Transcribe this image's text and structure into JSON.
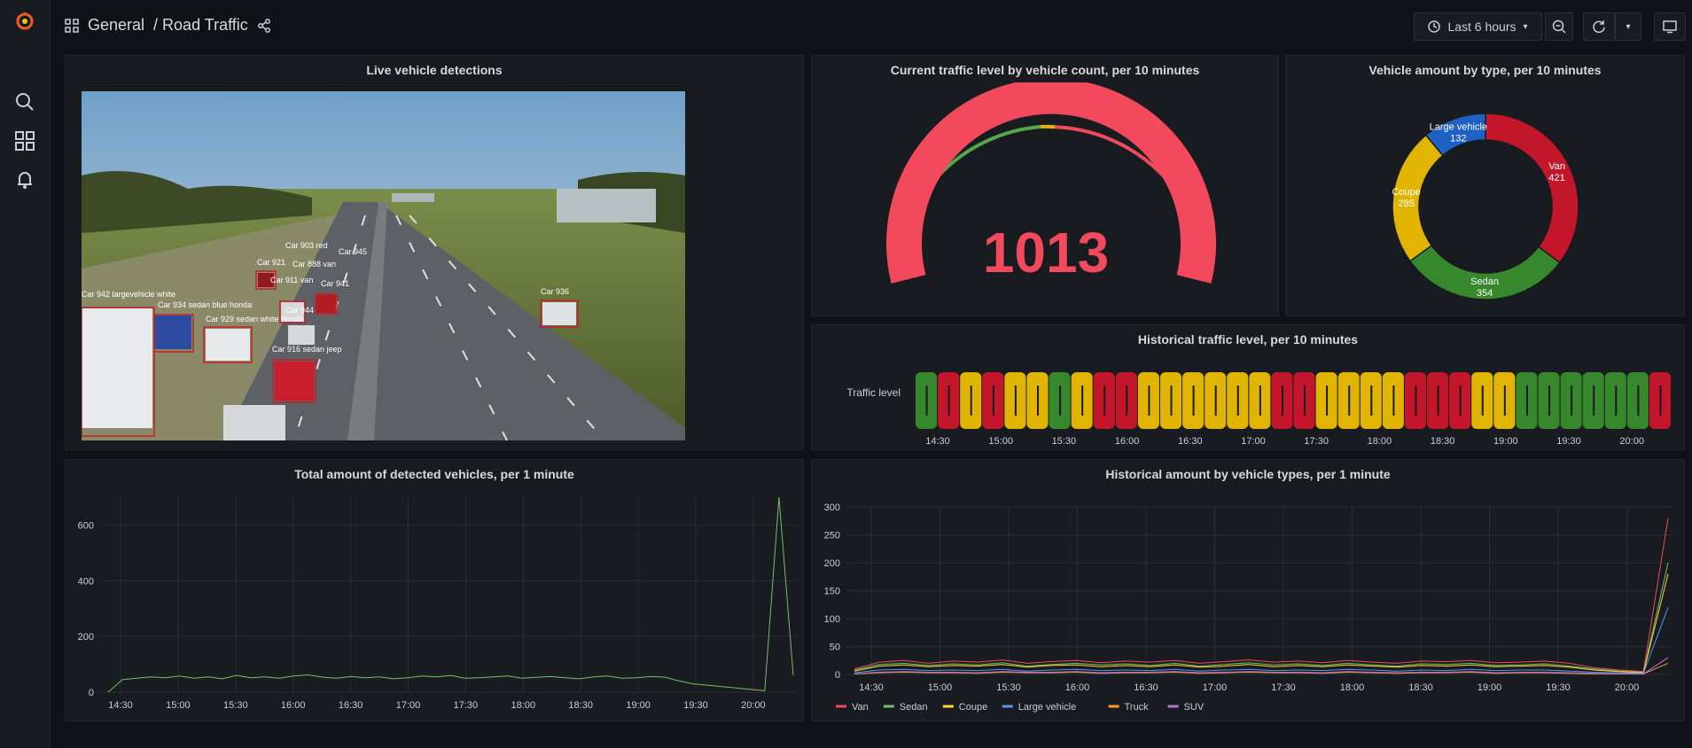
{
  "breadcrumb": {
    "folder": "General",
    "title": "/ Road Traffic"
  },
  "toolbar": {
    "time_range": "Last 6 hours"
  },
  "panels": {
    "live": {
      "title": "Live vehicle detections"
    },
    "gauge": {
      "title": "Current traffic level by vehicle count, per 10 minutes",
      "value": "1013",
      "min": 0,
      "max": 1000
    },
    "pie": {
      "title": "Vehicle amount by type, per 10 minutes"
    },
    "hist_level": {
      "title": "Historical traffic level, per 10 minutes",
      "row_label": "Traffic level"
    },
    "total": {
      "title": "Total amount of detected vehicles, per 1 minute"
    },
    "types": {
      "title": "Historical amount by vehicle types, per 1 minute"
    }
  },
  "detections": [
    "Car 942 largevehicle white",
    "Car 934 sedan blue honda",
    "Car 929 sedan white honda",
    "Car 921",
    "Car 903 red",
    "Car 888 van",
    "Car 945",
    "Car 911 van",
    "Car 941",
    "Car 944",
    "Car 916 sedan jeep",
    "Car 936"
  ],
  "colors": {
    "red": "#f2495c",
    "green": "#56a64b",
    "yellow": "#e0b400",
    "blue": "#3274d9",
    "orange": "#ff780a",
    "purple": "#a352cc"
  },
  "chart_data": [
    {
      "type": "pie",
      "title": "Vehicle amount by type, per 10 minutes",
      "slices": [
        {
          "name": "Van",
          "value": 421,
          "color": "#c4162a"
        },
        {
          "name": "Sedan",
          "value": 354,
          "color": "#37872d"
        },
        {
          "name": "Coupe",
          "value": 285,
          "color": "#e0b400"
        },
        {
          "name": "Large vehicle",
          "value": 132,
          "color": "#1f60c4"
        }
      ]
    },
    {
      "type": "heatmap",
      "title": "Historical traffic level, per 10 minutes",
      "row_label": "Traffic level",
      "x_ticks": [
        "14:30",
        "15:00",
        "15:30",
        "16:00",
        "16:30",
        "17:00",
        "17:30",
        "18:00",
        "18:30",
        "19:00",
        "19:30",
        "20:00"
      ],
      "levels": [
        "green",
        "red",
        "yellow",
        "red",
        "yellow",
        "yellow",
        "green",
        "yellow",
        "red",
        "red",
        "yellow",
        "yellow",
        "yellow",
        "yellow",
        "yellow",
        "yellow",
        "red",
        "red",
        "yellow",
        "yellow",
        "yellow",
        "yellow",
        "red",
        "red",
        "red",
        "yellow",
        "yellow",
        "green",
        "green",
        "green",
        "green",
        "green",
        "green",
        "red"
      ]
    },
    {
      "type": "line",
      "title": "Total amount of detected vehicles, per 1 minute",
      "x_ticks": [
        "14:30",
        "15:00",
        "15:30",
        "16:00",
        "16:30",
        "17:00",
        "17:30",
        "18:00",
        "18:30",
        "19:00",
        "19:30",
        "20:00"
      ],
      "ylim": [
        0,
        700
      ],
      "y_ticks": [
        0,
        200,
        400,
        600
      ],
      "series": [
        {
          "color": "#73bf69",
          "values": [
            0,
            45,
            50,
            55,
            52,
            58,
            50,
            55,
            48,
            60,
            52,
            55,
            50,
            58,
            62,
            54,
            50,
            56,
            52,
            55,
            48,
            52,
            58,
            55,
            60,
            50,
            52,
            55,
            58,
            50,
            53,
            56,
            52,
            48,
            55,
            58,
            50,
            52,
            56,
            54,
            40,
            30,
            25,
            20,
            15,
            10,
            5,
            700,
            60
          ]
        }
      ]
    },
    {
      "type": "line",
      "title": "Historical amount by vehicle types, per 1 minute",
      "x_ticks": [
        "14:30",
        "15:00",
        "15:30",
        "16:00",
        "16:30",
        "17:00",
        "17:30",
        "18:00",
        "18:30",
        "19:00",
        "19:30",
        "20:00"
      ],
      "ylim": [
        0,
        300
      ],
      "y_ticks": [
        0,
        50,
        100,
        150,
        200,
        250,
        300
      ],
      "series": [
        {
          "name": "Van",
          "color": "#f2495c",
          "values": [
            10,
            22,
            25,
            20,
            24,
            22,
            26,
            20,
            23,
            25,
            21,
            24,
            22,
            25,
            20,
            23,
            26,
            22,
            24,
            21,
            25,
            22,
            20,
            24,
            23,
            25,
            21,
            22,
            24,
            20,
            12,
            8,
            5,
            280
          ]
        },
        {
          "name": "Sedan",
          "color": "#73bf69",
          "values": [
            8,
            18,
            20,
            16,
            19,
            17,
            21,
            15,
            18,
            20,
            17,
            19,
            16,
            20,
            15,
            18,
            21,
            17,
            19,
            16,
            20,
            17,
            15,
            19,
            18,
            20,
            16,
            17,
            19,
            15,
            10,
            6,
            4,
            200
          ]
        },
        {
          "name": "Coupe",
          "color": "#fade2a",
          "values": [
            6,
            15,
            17,
            14,
            16,
            15,
            18,
            13,
            16,
            17,
            14,
            16,
            14,
            17,
            13,
            15,
            18,
            14,
            16,
            14,
            17,
            15,
            13,
            16,
            15,
            17,
            14,
            15,
            16,
            13,
            8,
            5,
            3,
            180
          ]
        },
        {
          "name": "Large vehicle",
          "color": "#5794f2",
          "values": [
            3,
            8,
            9,
            7,
            8,
            7,
            9,
            6,
            8,
            9,
            7,
            8,
            7,
            9,
            6,
            8,
            9,
            7,
            8,
            7,
            9,
            8,
            6,
            8,
            7,
            9,
            7,
            8,
            8,
            6,
            4,
            3,
            2,
            120
          ]
        },
        {
          "name": "Truck",
          "color": "#ff9830",
          "values": [
            1,
            3,
            4,
            3,
            3,
            2,
            4,
            3,
            3,
            4,
            2,
            3,
            3,
            4,
            2,
            3,
            4,
            3,
            3,
            2,
            4,
            3,
            2,
            3,
            3,
            4,
            2,
            3,
            3,
            2,
            1,
            1,
            1,
            20
          ]
        },
        {
          "name": "SUV",
          "color": "#b877d9",
          "values": [
            1,
            4,
            5,
            4,
            4,
            3,
            5,
            4,
            4,
            5,
            3,
            4,
            4,
            5,
            3,
            4,
            5,
            4,
            4,
            3,
            5,
            4,
            3,
            4,
            4,
            5,
            3,
            4,
            4,
            3,
            2,
            1,
            1,
            30
          ]
        }
      ]
    }
  ]
}
